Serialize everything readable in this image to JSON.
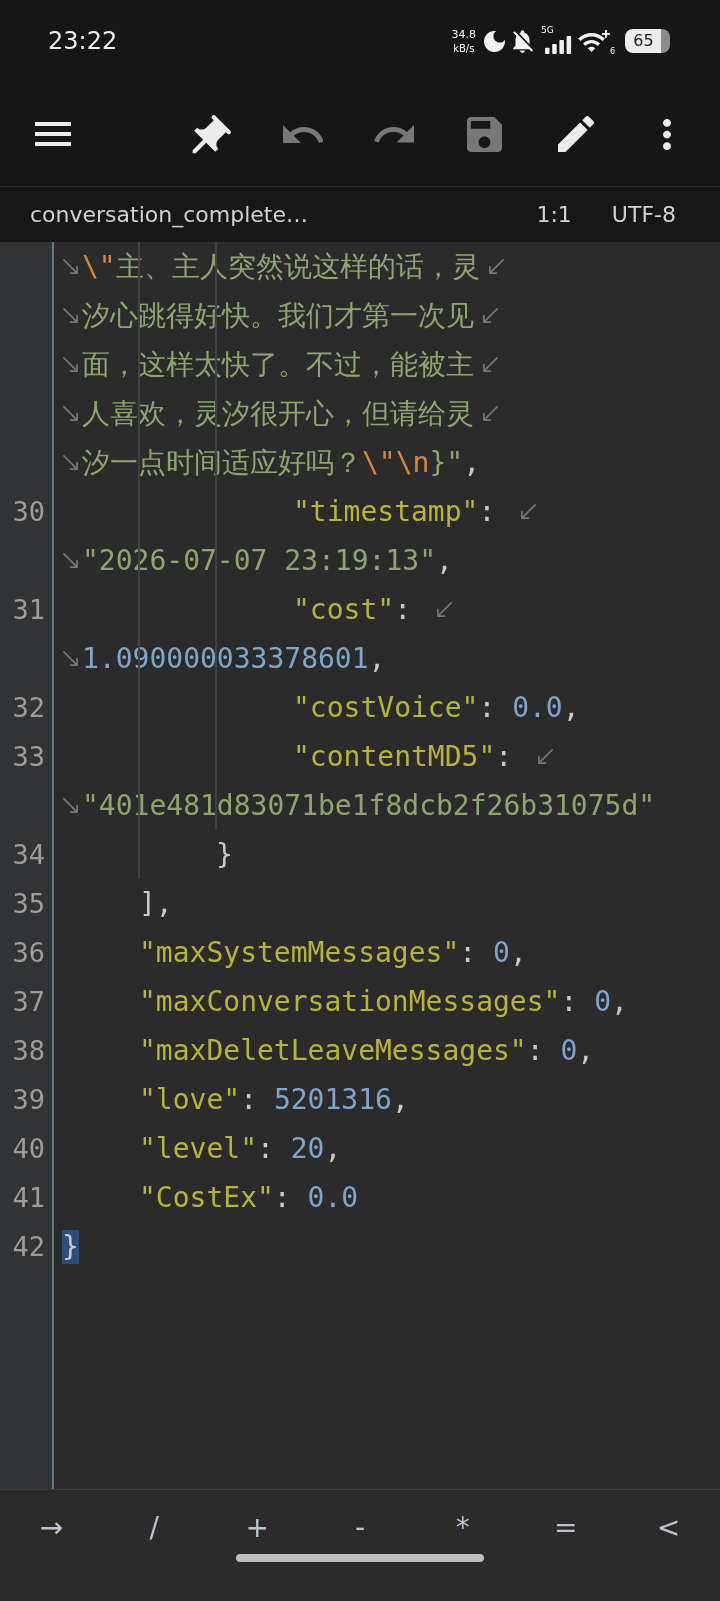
{
  "status_bar": {
    "time": "23:22",
    "net_speed": {
      "value": "34.8",
      "unit": "kB/s"
    },
    "network_type": "5G",
    "wifi_generation": "6",
    "battery": "65"
  },
  "toolbar": {
    "buttons": [
      {
        "kind": "menu",
        "disabled": false
      },
      {
        "kind": "pin",
        "disabled": false
      },
      {
        "kind": "undo",
        "disabled": true
      },
      {
        "kind": "redo",
        "disabled": true
      },
      {
        "kind": "save",
        "disabled": true
      },
      {
        "kind": "edit",
        "disabled": false
      },
      {
        "kind": "more",
        "disabled": false
      }
    ]
  },
  "file_bar": {
    "file_name": "conversation_complete…",
    "cursor_position": "1:1",
    "encoding": "UTF-8"
  },
  "editor": {
    "lines": [
      {
        "children": [
          {
            "children": [
              {
                "children": [
                  {
                    "rows": [
                      {
                        "continued": true,
                        "wraps": true,
                        "segments": [
                          {
                            "kind": "escape",
                            "text": "\\\""
                          },
                          {
                            "kind": "string",
                            "text": "主、主人突然说这样的话，灵"
                          }
                        ]
                      },
                      {
                        "continued": true,
                        "wraps": true,
                        "segments": [
                          {
                            "kind": "string",
                            "text": "汐心跳得好快。我们才第一次见"
                          }
                        ]
                      },
                      {
                        "continued": true,
                        "wraps": true,
                        "segments": [
                          {
                            "kind": "string",
                            "text": "面，这样太快了。不过，能被主"
                          }
                        ]
                      },
                      {
                        "continued": true,
                        "wraps": true,
                        "segments": [
                          {
                            "kind": "string",
                            "text": "人喜欢，灵汐很开心，但请给灵"
                          }
                        ]
                      },
                      {
                        "continued": true,
                        "wraps": false,
                        "segments": [
                          {
                            "kind": "string",
                            "text": "汐一点时间适应好吗？"
                          },
                          {
                            "kind": "escape",
                            "text": "\\\"\\n"
                          },
                          {
                            "kind": "string",
                            "text": "}\""
                          },
                          {
                            "kind": "punctuation",
                            "text": ","
                          }
                        ]
                      }
                    ]
                  },
                  {
                    "number": "30",
                    "rows": [
                      {
                        "continued": false,
                        "wraps": true,
                        "segments": [
                          {
                            "kind": "key",
                            "text": "\"timestamp\""
                          },
                          {
                            "kind": "punctuation",
                            "text": ": "
                          }
                        ]
                      },
                      {
                        "continued": true,
                        "wraps": false,
                        "segments": [
                          {
                            "kind": "string",
                            "text": "\"2026-07-07 23:19:13\""
                          },
                          {
                            "kind": "punctuation",
                            "text": ","
                          }
                        ]
                      }
                    ]
                  },
                  {
                    "number": "31",
                    "rows": [
                      {
                        "continued": false,
                        "wraps": true,
                        "segments": [
                          {
                            "kind": "key",
                            "text": "\"cost\""
                          },
                          {
                            "kind": "punctuation",
                            "text": ": "
                          }
                        ]
                      },
                      {
                        "continued": true,
                        "wraps": false,
                        "segments": [
                          {
                            "kind": "number",
                            "text": "1.090000033378601"
                          },
                          {
                            "kind": "punctuation",
                            "text": ","
                          }
                        ]
                      }
                    ]
                  },
                  {
                    "number": "32",
                    "rows": [
                      {
                        "continued": false,
                        "wraps": false,
                        "segments": [
                          {
                            "kind": "key",
                            "text": "\"costVoice\""
                          },
                          {
                            "kind": "punctuation",
                            "text": ": "
                          },
                          {
                            "kind": "number",
                            "text": "0.0"
                          },
                          {
                            "kind": "punctuation",
                            "text": ","
                          }
                        ]
                      }
                    ]
                  },
                  {
                    "number": "33",
                    "rows": [
                      {
                        "continued": false,
                        "wraps": true,
                        "segments": [
                          {
                            "kind": "key",
                            "text": "\"contentMD5\""
                          },
                          {
                            "kind": "punctuation",
                            "text": ": "
                          }
                        ]
                      },
                      {
                        "continued": true,
                        "wraps": false,
                        "segments": [
                          {
                            "kind": "string",
                            "text": "\"401e481d83071be1f8dcb2f26b31075d\""
                          }
                        ]
                      }
                    ]
                  }
                ]
              },
              {
                "number": "34",
                "rows": [
                  {
                    "continued": false,
                    "wraps": false,
                    "segments": [
                      {
                        "kind": "punctuation",
                        "text": "}"
                      }
                    ]
                  }
                ]
              }
            ]
          },
          {
            "number": "35",
            "rows": [
              {
                "continued": false,
                "wraps": false,
                "segments": [
                  {
                    "kind": "punctuation",
                    "text": "],"
                  }
                ]
              }
            ]
          },
          {
            "number": "36",
            "rows": [
              {
                "continued": false,
                "wraps": false,
                "segments": [
                  {
                    "kind": "key",
                    "text": "\"maxSystemMessages\""
                  },
                  {
                    "kind": "punctuation",
                    "text": ": "
                  },
                  {
                    "kind": "number",
                    "text": "0"
                  },
                  {
                    "kind": "punctuation",
                    "text": ","
                  }
                ]
              }
            ]
          },
          {
            "number": "37",
            "rows": [
              {
                "continued": false,
                "wraps": false,
                "segments": [
                  {
                    "kind": "key",
                    "text": "\"maxConversationMessages\""
                  },
                  {
                    "kind": "punctuation",
                    "text": ": "
                  },
                  {
                    "kind": "number",
                    "text": "0"
                  },
                  {
                    "kind": "punctuation",
                    "text": ","
                  }
                ]
              }
            ]
          },
          {
            "number": "38",
            "rows": [
              {
                "continued": false,
                "wraps": false,
                "segments": [
                  {
                    "kind": "key",
                    "text": "\"maxDeletLeaveMessages\""
                  },
                  {
                    "kind": "punctuation",
                    "text": ": "
                  },
                  {
                    "kind": "number",
                    "text": "0"
                  },
                  {
                    "kind": "punctuation",
                    "text": ","
                  }
                ]
              }
            ]
          },
          {
            "number": "39",
            "rows": [
              {
                "continued": false,
                "wraps": false,
                "segments": [
                  {
                    "kind": "key",
                    "text": "\"love\""
                  },
                  {
                    "kind": "punctuation",
                    "text": ": "
                  },
                  {
                    "kind": "number",
                    "text": "5201316"
                  },
                  {
                    "kind": "punctuation",
                    "text": ","
                  }
                ]
              }
            ]
          },
          {
            "number": "40",
            "rows": [
              {
                "continued": false,
                "wraps": false,
                "segments": [
                  {
                    "kind": "key",
                    "text": "\"level\""
                  },
                  {
                    "kind": "punctuation",
                    "text": ": "
                  },
                  {
                    "kind": "number",
                    "text": "20"
                  },
                  {
                    "kind": "punctuation",
                    "text": ","
                  }
                ]
              }
            ]
          },
          {
            "number": "41",
            "rows": [
              {
                "continued": false,
                "wraps": false,
                "segments": [
                  {
                    "kind": "key",
                    "text": "\"CostEx\""
                  },
                  {
                    "kind": "punctuation",
                    "text": ": "
                  },
                  {
                    "kind": "number",
                    "text": "0.0"
                  }
                ]
              }
            ]
          }
        ]
      },
      {
        "number": "42",
        "rows": [
          {
            "continued": false,
            "wraps": false,
            "segments": [
              {
                "kind": "punctuation",
                "text": "}",
                "highlighted": true
              }
            ]
          }
        ]
      }
    ]
  },
  "symbol_bar": {
    "keys": [
      "→",
      "/",
      "+",
      "-",
      "*",
      "=",
      "<"
    ]
  }
}
